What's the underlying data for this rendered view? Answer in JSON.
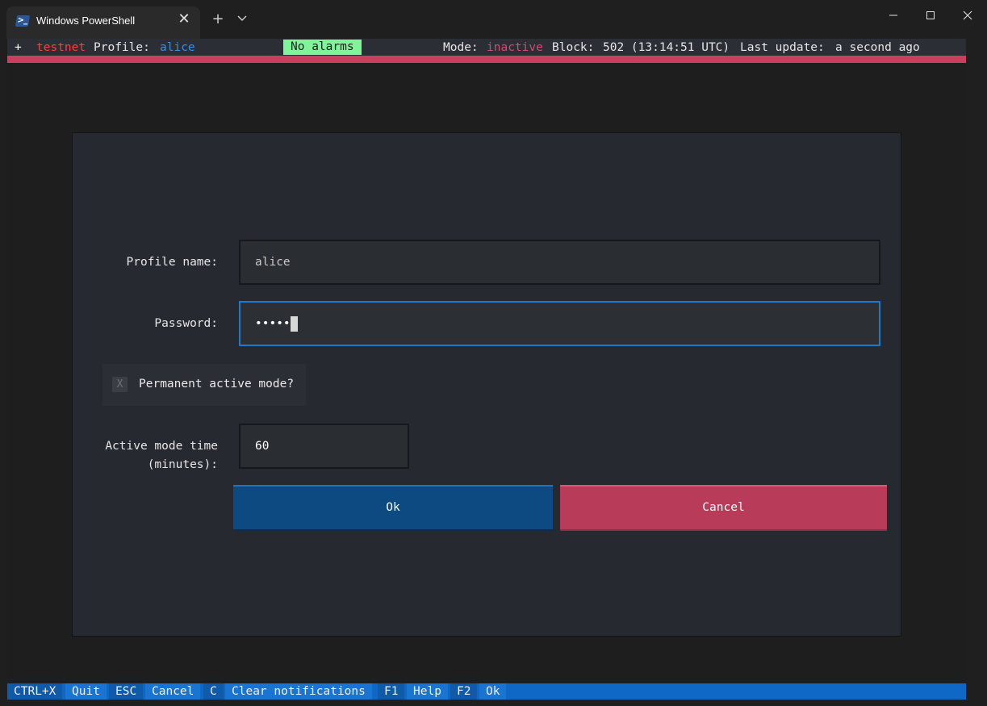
{
  "window": {
    "tab_title": "Windows PowerShell",
    "tab_icon": "powershell-icon",
    "close_tab_glyph": "✕",
    "new_tab_glyph": "+",
    "dropdown_glyph": "⌄",
    "minimize_glyph": "—",
    "maximize_glyph": "☐",
    "close_glyph": "✕"
  },
  "status": {
    "plus": "+",
    "network": "testnet",
    "profile_label": "Profile:",
    "profile_value": "alice",
    "alarms": "No alarms",
    "mode_label": "Mode:",
    "mode_value": "inactive",
    "block_label": "Block:",
    "block_value": "502 (13:14:51 UTC)",
    "update_label": "Last update:",
    "update_value": "a second ago"
  },
  "form": {
    "profile_name_label": "Profile name:",
    "profile_name_value": "alice",
    "password_label": "Password:",
    "password_value": "•••••",
    "checkbox_mark": "X",
    "checkbox_label": "Permanent active mode?",
    "active_time_label_1": "Active mode time",
    "active_time_label_2": "(minutes):",
    "active_time_value": "60",
    "ok_button": "Ok",
    "cancel_button": "Cancel"
  },
  "footer": [
    {
      "key": "CTRL+X",
      "action": "Quit"
    },
    {
      "key": "ESC",
      "action": "Cancel"
    },
    {
      "key": "C",
      "action": "Clear notifications"
    },
    {
      "key": "F1",
      "action": "Help"
    },
    {
      "key": "F2",
      "action": "Ok"
    }
  ],
  "colors": {
    "accent_red": "#c7405e",
    "alarm_green": "#7ff59a",
    "link_blue": "#3a8de0",
    "footer_blue": "#0f67c6"
  }
}
